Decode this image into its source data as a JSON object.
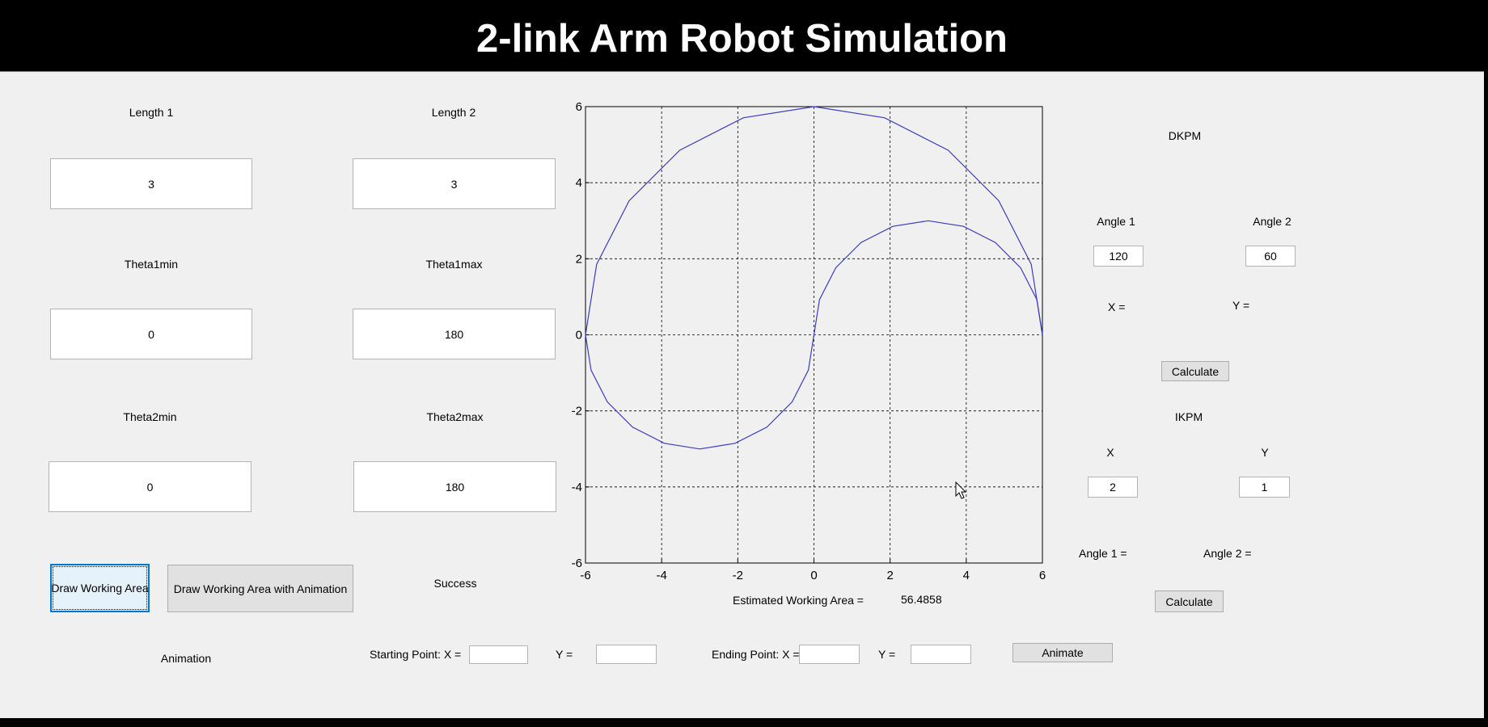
{
  "title": "2-link Arm Robot Simulation",
  "params": {
    "length1_label": "Length 1",
    "length1_value": "3",
    "length2_label": "Length 2",
    "length2_value": "3",
    "theta1min_label": "Theta1min",
    "theta1min_value": "0",
    "theta1max_label": "Theta1max",
    "theta1max_value": "180",
    "theta2min_label": "Theta2min",
    "theta2min_value": "0",
    "theta2max_label": "Theta2max",
    "theta2max_value": "180"
  },
  "buttons": {
    "draw_working_area": "Draw Working Area",
    "draw_with_animation": "Draw Working Area with Animation",
    "status": "Success"
  },
  "plot": {
    "estimated_area_label": "Estimated Working Area  =",
    "estimated_area_value": "56.4858"
  },
  "chart_data": {
    "type": "line",
    "title": "",
    "xlabel": "",
    "ylabel": "",
    "xlim": [
      -6,
      6
    ],
    "ylim": [
      -6,
      6
    ],
    "xticks": [
      -6,
      -4,
      -2,
      0,
      2,
      4,
      6
    ],
    "yticks": [
      -6,
      -4,
      -2,
      0,
      2,
      4,
      6
    ],
    "grid": true,
    "line_color": "#3c3cbe",
    "series": [
      {
        "points": [
          [
            6,
            0
          ],
          [
            5.7063,
            1.8541
          ],
          [
            4.8541,
            3.5267
          ],
          [
            3.5267,
            4.8541
          ],
          [
            1.8541,
            5.7063
          ],
          [
            0,
            6
          ],
          [
            -1.8541,
            5.7063
          ],
          [
            -3.5267,
            4.8541
          ],
          [
            -4.8541,
            3.5267
          ],
          [
            -5.7063,
            1.8541
          ],
          [
            -6,
            0
          ]
        ]
      },
      {
        "points": [
          [
            0,
            0
          ],
          [
            0.1474,
            0.9271
          ],
          [
            0.5729,
            1.7634
          ],
          [
            1.2366,
            2.4271
          ],
          [
            2.0729,
            2.8532
          ],
          [
            3,
            3
          ],
          [
            3.9271,
            2.8532
          ],
          [
            4.7634,
            2.4271
          ],
          [
            5.4271,
            1.7634
          ],
          [
            5.8532,
            0.9271
          ],
          [
            6,
            0
          ]
        ]
      },
      {
        "points": [
          [
            0,
            0
          ],
          [
            -0.1474,
            -0.9271
          ],
          [
            -0.5729,
            -1.7634
          ],
          [
            -1.2366,
            -2.4271
          ],
          [
            -2.0729,
            -2.8532
          ],
          [
            -3,
            -3
          ],
          [
            -3.9271,
            -2.8532
          ],
          [
            -4.7634,
            -2.4271
          ],
          [
            -5.4271,
            -1.7634
          ],
          [
            -5.8532,
            -0.9271
          ],
          [
            -6,
            0
          ]
        ]
      }
    ]
  },
  "dkpm": {
    "title": "DKPM",
    "angle1_label": "Angle 1",
    "angle1_value": "120",
    "angle2_label": "Angle 2",
    "angle2_value": "60",
    "x_label": "X =",
    "y_label": "Y =",
    "calculate": "Calculate"
  },
  "ikpm": {
    "title": "IKPM",
    "x_label": "X",
    "x_value": "2",
    "y_label": "Y",
    "y_value": "1",
    "angle1_label": "Angle 1 =",
    "angle2_label": "Angle 2 =",
    "calculate": "Calculate"
  },
  "animation": {
    "label": "Animation",
    "start_label": "Starting Point: X =",
    "start_x": "",
    "start_y_label": "Y =",
    "start_y": "",
    "end_label": "Ending Point: X =",
    "end_x": "",
    "end_y_label": "Y =",
    "end_y": "",
    "animate": "Animate"
  }
}
